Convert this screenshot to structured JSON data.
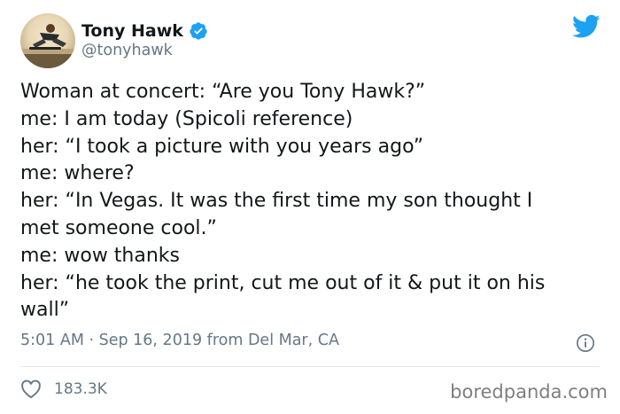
{
  "tweet": {
    "author_name": "Tony Hawk",
    "author_handle": "@tonyhawk",
    "lines": [
      "Woman at concert: “Are you Tony Hawk?”",
      "me: I am today (Spicoli reference)",
      "her: “I took a picture with you years ago”",
      "me: where?",
      "her: “In Vegas. It was the first time my son thought I",
      "met someone cool.”",
      "me: wow thanks",
      "her: “he took the print, cut me out of it & put it on his",
      "wall”"
    ],
    "timestamp": "5:01 AM · Sep 16, 2019 from Del Mar, CA",
    "like_count": "183.3K"
  },
  "watermark": "boredpanda.com",
  "icons": {
    "verified": "verified-badge-icon",
    "bird": "twitter-bird-icon",
    "info": "info-icon",
    "heart": "heart-icon"
  },
  "colors": {
    "twitter_blue": "#1da1f2",
    "text": "#14171a",
    "secondary": "#657786"
  }
}
